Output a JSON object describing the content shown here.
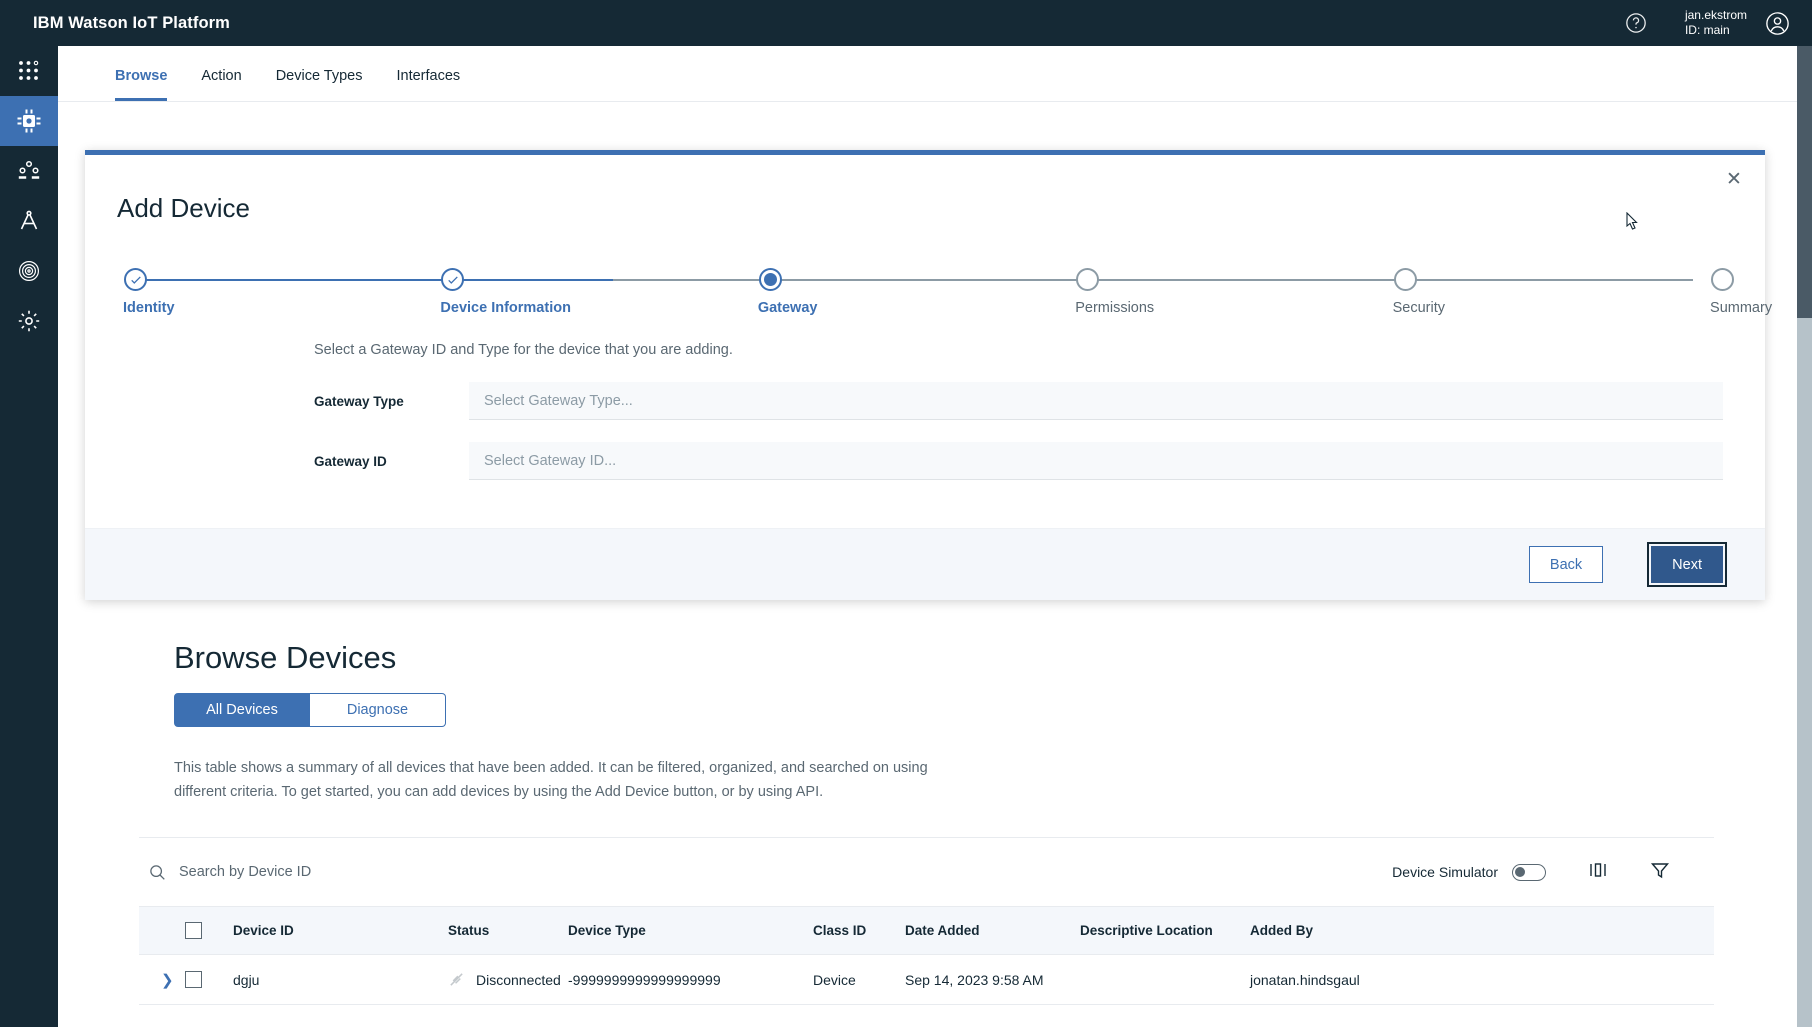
{
  "header": {
    "title": "IBM Watson IoT Platform",
    "help_icon": "help-circle-icon",
    "user_name": "jan.ekstrom",
    "user_id": "ID: main",
    "avatar_icon": "user-avatar-icon"
  },
  "rail": {
    "items": [
      {
        "icon": "apps-grid-icon",
        "name": "sidebar-item-apps",
        "active": false
      },
      {
        "icon": "chip-icon",
        "name": "sidebar-item-devices",
        "active": true
      },
      {
        "icon": "users-icon",
        "name": "sidebar-item-users",
        "active": false
      },
      {
        "icon": "compass-drafting-icon",
        "name": "sidebar-item-boards",
        "active": false
      },
      {
        "icon": "fingerprint-icon",
        "name": "sidebar-item-security",
        "active": false
      },
      {
        "icon": "gear-icon",
        "name": "sidebar-item-settings",
        "active": false
      }
    ]
  },
  "tabs": [
    {
      "label": "Browse",
      "active": true
    },
    {
      "label": "Action",
      "active": false
    },
    {
      "label": "Device Types",
      "active": false
    },
    {
      "label": "Interfaces",
      "active": false
    }
  ],
  "modal": {
    "title": "Add Device",
    "close_icon": "close-icon",
    "steps": [
      {
        "label": "Identity",
        "state": "done"
      },
      {
        "label": "Device Information",
        "state": "done"
      },
      {
        "label": "Gateway",
        "state": "current"
      },
      {
        "label": "Permissions",
        "state": "todo"
      },
      {
        "label": "Security",
        "state": "todo"
      },
      {
        "label": "Summary",
        "state": "todo"
      }
    ],
    "hint": "Select a Gateway ID and Type for the device that you are adding.",
    "fields": [
      {
        "label": "Gateway Type",
        "placeholder": "Select Gateway Type...",
        "value": ""
      },
      {
        "label": "Gateway ID",
        "placeholder": "Select Gateway ID...",
        "value": ""
      }
    ],
    "back_label": "Back",
    "next_label": "Next"
  },
  "browse": {
    "title": "Browse Devices",
    "segments": [
      {
        "label": "All Devices",
        "active": true
      },
      {
        "label": "Diagnose",
        "active": false
      }
    ],
    "description": "This table shows a summary of all devices that have been added. It can be filtered, organized, and searched on using different criteria. To get started, you can add devices by using the Add Device button, or by using API.",
    "search_placeholder": "Search by Device ID",
    "search_value": "",
    "search_icon": "search-icon",
    "simulator_label": "Device Simulator",
    "simulator_on": false,
    "columns_icon": "columns-icon",
    "filter_icon": "filter-icon"
  },
  "table": {
    "columns": [
      "Device ID",
      "Status",
      "Device Type",
      "Class ID",
      "Date Added",
      "Descriptive Location",
      "Added By"
    ],
    "rows": [
      {
        "device_id": "dgju",
        "status": "Disconnected",
        "status_icon": "disconnected-icon",
        "device_type": "-9999999999999999999",
        "class_id": "Device",
        "date_added": "Sep 14, 2023 9:58 AM",
        "descriptive_location": "",
        "added_by": "jonatan.hindsgaul"
      }
    ]
  },
  "colors": {
    "brand_dark": "#152935",
    "accent_blue": "#3d70b2",
    "muted": "#5a6872"
  }
}
